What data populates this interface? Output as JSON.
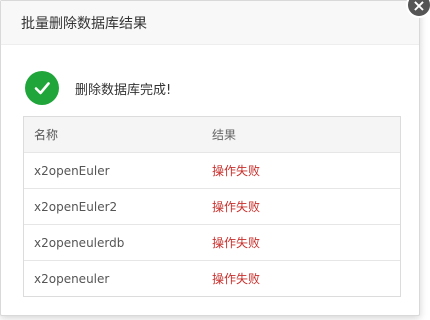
{
  "dialog": {
    "title": "批量删除数据库结果",
    "close_label": "×",
    "status_text": "删除数据库完成!",
    "table": {
      "columns": [
        "名称",
        "结果"
      ],
      "rows": [
        {
          "name": "x2openEuler",
          "result": "操作失败"
        },
        {
          "name": "x2openEuler2",
          "result": "操作失败"
        },
        {
          "name": "x2openeulerdb",
          "result": "操作失败"
        },
        {
          "name": "x2openeuler",
          "result": "操作失败"
        }
      ]
    },
    "colors": {
      "success": "#20a53a",
      "fail": "#c9302c"
    }
  }
}
